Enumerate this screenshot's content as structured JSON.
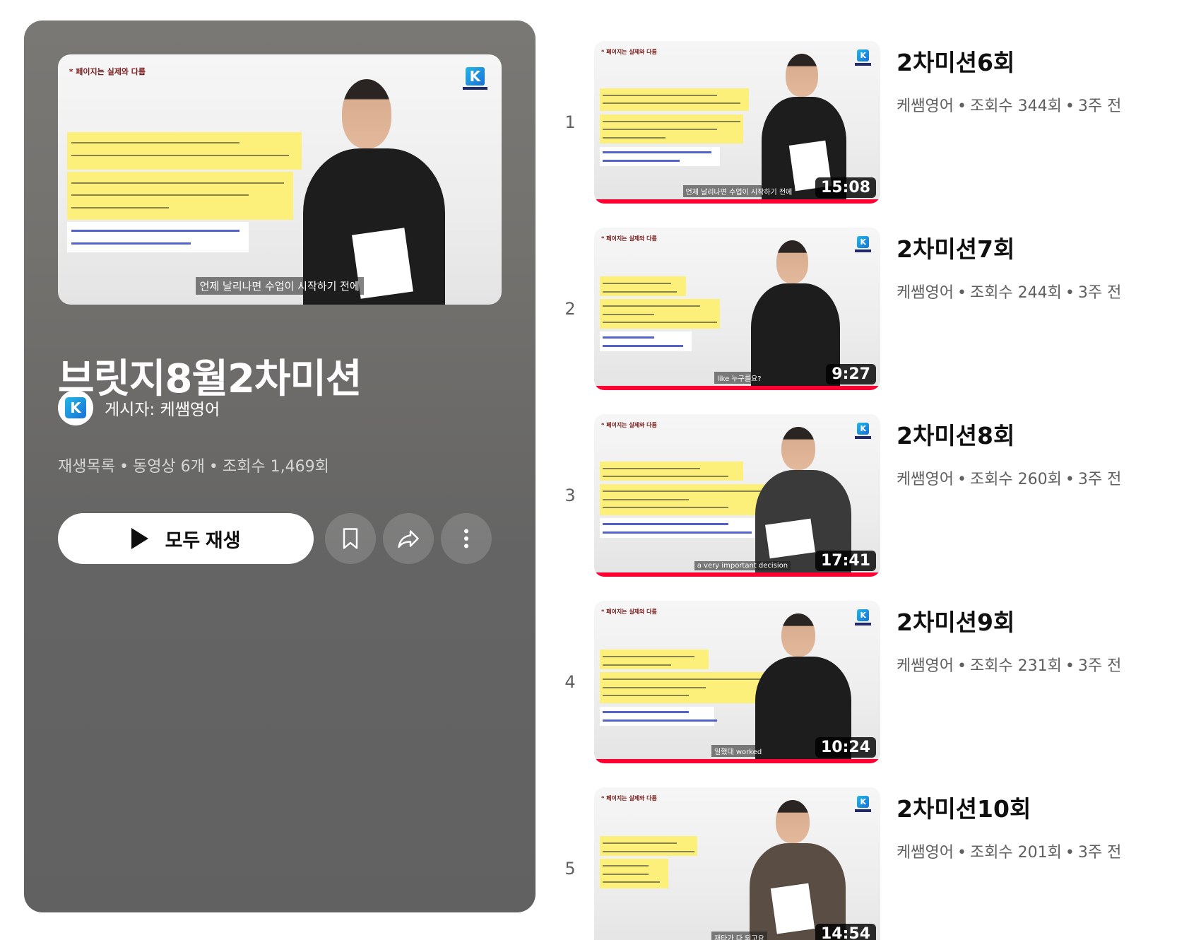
{
  "playlist": {
    "title": "브릿지8월2차미션",
    "owner_label": "게시자: 케쌤영어",
    "meta": {
      "type": "재생목록",
      "videos": "동영상 6개",
      "views": "조회수 1,469회"
    },
    "play_all_label": "모두 재생",
    "hero_caption": "언제 날리나면 수업이 시작하기 전에",
    "note": "* 페이지는 실제와 다름",
    "channel_logo_letter": "K"
  },
  "videos": [
    {
      "index": "1",
      "title": "2차미션6회",
      "channel": "케쌤영어",
      "views": "조회수 344회",
      "age": "3주 전",
      "duration": "15:08",
      "caption": "언제 날리나면 수업이 시작하기 전에",
      "watched": 1.0
    },
    {
      "index": "2",
      "title": "2차미션7회",
      "channel": "케쌤영어",
      "views": "조회수 244회",
      "age": "3주 전",
      "duration": "9:27",
      "caption": "like 누구를요?",
      "watched": 1.0
    },
    {
      "index": "3",
      "title": "2차미션8회",
      "channel": "케쌤영어",
      "views": "조회수 260회",
      "age": "3주 전",
      "duration": "17:41",
      "caption": "a very important decision",
      "watched": 1.0
    },
    {
      "index": "4",
      "title": "2차미션9회",
      "channel": "케쌤영어",
      "views": "조회수 231회",
      "age": "3주 전",
      "duration": "10:24",
      "caption": "일했대 worked",
      "watched": 1.0
    },
    {
      "index": "5",
      "title": "2차미션10회",
      "channel": "케쌤영어",
      "views": "조회수 201회",
      "age": "3주 전",
      "duration": "14:54",
      "caption": "재타가 다 되고요",
      "watched": 1.0
    }
  ],
  "icons": {
    "save": "bookmark-icon",
    "share": "share-icon",
    "more": "more-vert-icon",
    "play": "play-icon"
  },
  "colors": {
    "progress": "#ff0033",
    "panel": "#646464",
    "highlight": "#fcf07a"
  }
}
